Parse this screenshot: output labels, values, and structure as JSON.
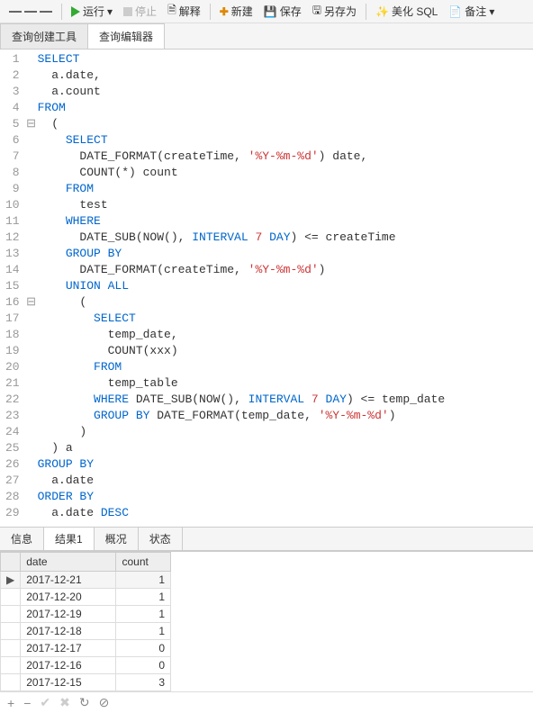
{
  "toolbar": {
    "run": "运行",
    "stop": "停止",
    "explain": "解释",
    "new": "新建",
    "save": "保存",
    "saveas": "另存为",
    "beautify": "美化 SQL",
    "note": "备注"
  },
  "tabs": {
    "query_builder": "查询创建工具",
    "query_editor": "查询编辑器"
  },
  "code": {
    "lines": 29,
    "tokens": [
      [
        [
          "kw",
          "SELECT"
        ]
      ],
      [
        [
          "pl",
          "  a.date,"
        ]
      ],
      [
        [
          "pl",
          "  a.count"
        ]
      ],
      [
        [
          "kw",
          "FROM"
        ]
      ],
      [
        [
          "pl",
          "  ("
        ]
      ],
      [
        [
          "pl",
          "    "
        ],
        [
          "kw",
          "SELECT"
        ]
      ],
      [
        [
          "pl",
          "      DATE_FORMAT(createTime, "
        ],
        [
          "str",
          "'%Y-%m-%d'"
        ],
        [
          "pl",
          ") date,"
        ]
      ],
      [
        [
          "pl",
          "      COUNT(*) count"
        ]
      ],
      [
        [
          "pl",
          "    "
        ],
        [
          "kw",
          "FROM"
        ]
      ],
      [
        [
          "pl",
          "      test"
        ]
      ],
      [
        [
          "pl",
          "    "
        ],
        [
          "kw",
          "WHERE"
        ]
      ],
      [
        [
          "pl",
          "      DATE_SUB(NOW(), "
        ],
        [
          "kw",
          "INTERVAL"
        ],
        [
          "pl",
          " "
        ],
        [
          "num",
          "7"
        ],
        [
          "pl",
          " "
        ],
        [
          "kw",
          "DAY"
        ],
        [
          "pl",
          ") <= createTime"
        ]
      ],
      [
        [
          "pl",
          "    "
        ],
        [
          "kw",
          "GROUP BY"
        ]
      ],
      [
        [
          "pl",
          "      DATE_FORMAT(createTime, "
        ],
        [
          "str",
          "'%Y-%m-%d'"
        ],
        [
          "pl",
          ")"
        ]
      ],
      [
        [
          "pl",
          "    "
        ],
        [
          "kw",
          "UNION ALL"
        ]
      ],
      [
        [
          "pl",
          "      ("
        ]
      ],
      [
        [
          "pl",
          "        "
        ],
        [
          "kw",
          "SELECT"
        ]
      ],
      [
        [
          "pl",
          "          temp_date,"
        ]
      ],
      [
        [
          "pl",
          "          COUNT(xxx)"
        ]
      ],
      [
        [
          "pl",
          "        "
        ],
        [
          "kw",
          "FROM"
        ]
      ],
      [
        [
          "pl",
          "          temp_table"
        ]
      ],
      [
        [
          "pl",
          "        "
        ],
        [
          "kw",
          "WHERE"
        ],
        [
          "pl",
          " DATE_SUB(NOW(), "
        ],
        [
          "kw",
          "INTERVAL"
        ],
        [
          "pl",
          " "
        ],
        [
          "num",
          "7"
        ],
        [
          "pl",
          " "
        ],
        [
          "kw",
          "DAY"
        ],
        [
          "pl",
          ") <= temp_date"
        ]
      ],
      [
        [
          "pl",
          "        "
        ],
        [
          "kw",
          "GROUP BY"
        ],
        [
          "pl",
          " DATE_FORMAT(temp_date, "
        ],
        [
          "str",
          "'%Y-%m-%d'"
        ],
        [
          "pl",
          ")"
        ]
      ],
      [
        [
          "pl",
          "      )"
        ]
      ],
      [
        [
          "pl",
          "  ) a"
        ]
      ],
      [
        [
          "kw",
          "GROUP BY"
        ]
      ],
      [
        [
          "pl",
          "  a.date"
        ]
      ],
      [
        [
          "kw",
          "ORDER BY"
        ]
      ],
      [
        [
          "pl",
          "  a.date "
        ],
        [
          "kw",
          "DESC"
        ]
      ]
    ]
  },
  "bottom_tabs": {
    "info": "信息",
    "result1": "结果1",
    "profile": "概况",
    "status": "状态"
  },
  "grid": {
    "columns": [
      "date",
      "count"
    ],
    "rows": [
      [
        "2017-12-21",
        "1"
      ],
      [
        "2017-12-20",
        "1"
      ],
      [
        "2017-12-19",
        "1"
      ],
      [
        "2017-12-18",
        "1"
      ],
      [
        "2017-12-17",
        "0"
      ],
      [
        "2017-12-16",
        "0"
      ],
      [
        "2017-12-15",
        "3"
      ]
    ]
  },
  "fold": {
    "open5": "⊟",
    "open16": "⊟"
  }
}
